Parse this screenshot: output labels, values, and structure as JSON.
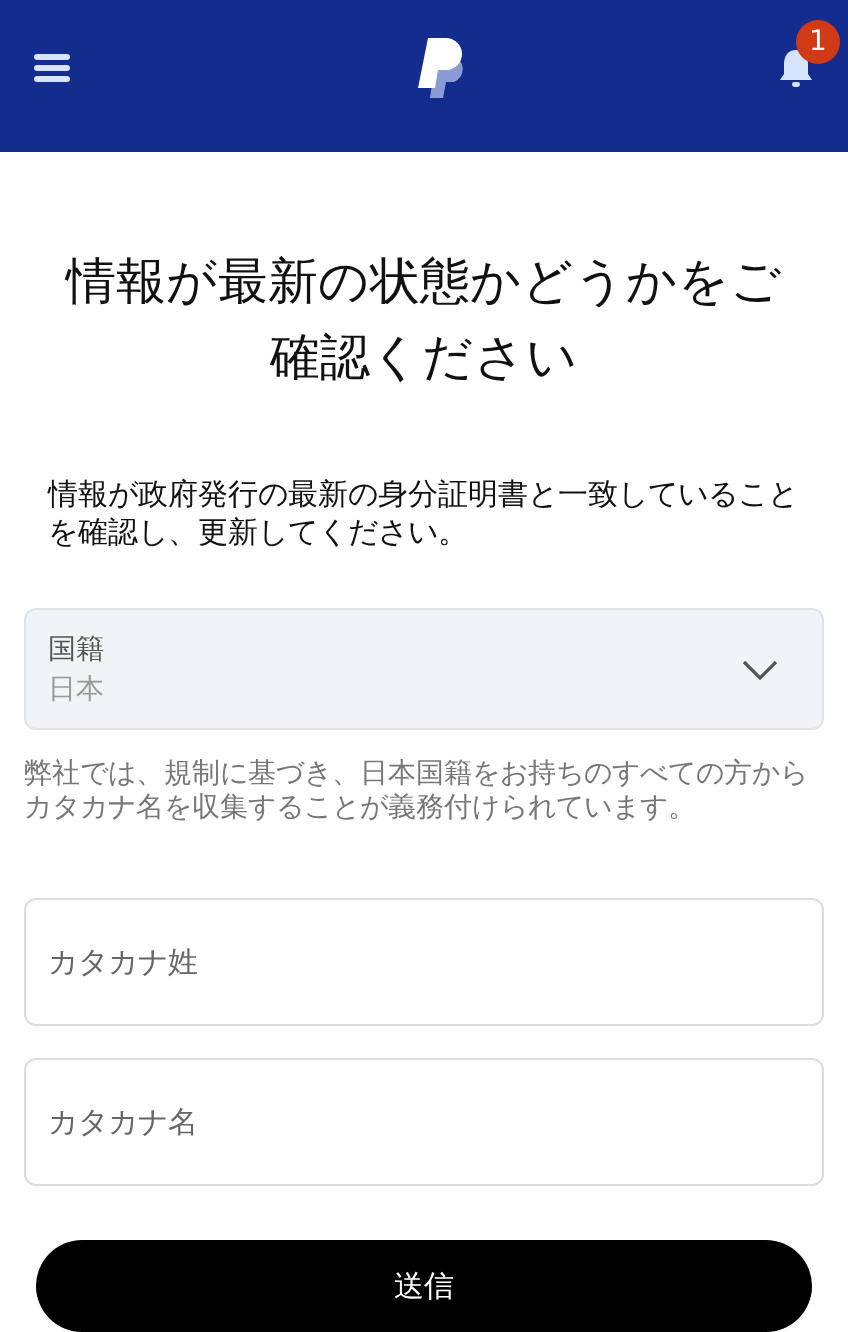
{
  "header": {
    "notification_count": "1"
  },
  "title": "情報が最新の状態かどうかをご確認ください",
  "intro": "情報が政府発行の最新の身分証明書と一致していることを確認し、更新してください。",
  "nationality": {
    "label": "国籍",
    "value": "日本",
    "disabled": true
  },
  "note": "弊社では、規制に基づき、日本国籍をお持ちのすべての方からカタカナ名を収集することが義務付けられています。",
  "fields": [
    {
      "placeholder": "カタカナ姓"
    },
    {
      "placeholder": "カタカナ名"
    }
  ],
  "submit": "送信"
}
